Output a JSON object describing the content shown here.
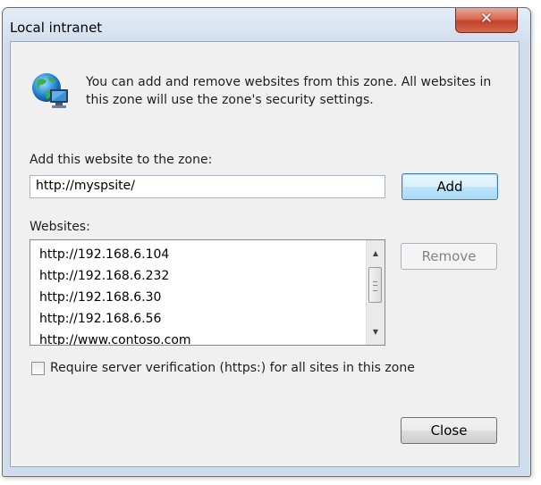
{
  "window": {
    "title": "Local intranet",
    "close_glyph": "✕"
  },
  "intro": {
    "icon": "globe-computer-icon",
    "text": "You can add and remove websites from this zone. All websites in this zone will use the zone's security settings."
  },
  "add_site": {
    "label": "Add this website to the zone:",
    "value": "http://myspsite/",
    "add_button": "Add"
  },
  "websites": {
    "label": "Websites:",
    "items": [
      "http://192.168.6.104",
      "http://192.168.6.232",
      "http://192.168.6.30",
      "http://192.168.6.56",
      "http://www.contoso.com"
    ],
    "remove_button": "Remove"
  },
  "options": {
    "require_https_label": "Require server verification (https:) for all sites in this zone",
    "require_https_checked": false
  },
  "footer": {
    "close_button": "Close"
  }
}
